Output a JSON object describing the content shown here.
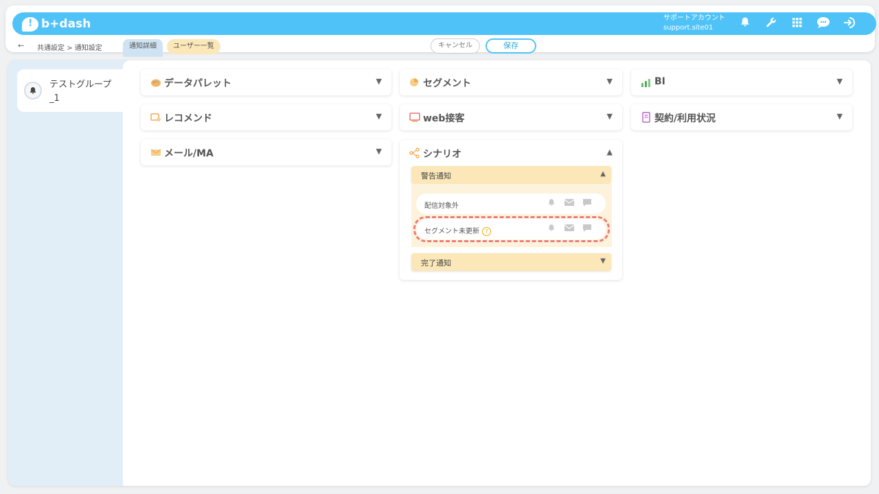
{
  "app": {
    "logo_text": "b+dash"
  },
  "account": {
    "name": "サポートアカウント",
    "site": "support.site01"
  },
  "header_icons": [
    "bell-icon",
    "wrench-icon",
    "grid-icon",
    "chat-icon",
    "logout-icon"
  ],
  "subbar": {
    "back_glyph": "←",
    "breadcrumb": "共通設定 > 通知設定",
    "tabs": [
      "通知詳細",
      "ユーザー一覧"
    ],
    "cancel_label": "キャンセル",
    "save_label": "保存"
  },
  "sidebar": {
    "groups": [
      {
        "label": "テストグループ_1"
      }
    ]
  },
  "categories": {
    "datapalette": "データパレット",
    "segment": "セグメント",
    "bi": "BI",
    "recommend": "レコメンド",
    "webservice": "web接客",
    "contract": "契約/利用状況",
    "mail": "メール/MA",
    "scenario": "シナリオ"
  },
  "scenario": {
    "warning_label": "警告通知",
    "complete_label": "完了通知",
    "rows": [
      "配信対象外",
      "セグメント未更新"
    ]
  },
  "colors": {
    "brand": "#4fc3f7",
    "tab_users": "#fbe7b8",
    "highlight": "#f07b7b"
  }
}
